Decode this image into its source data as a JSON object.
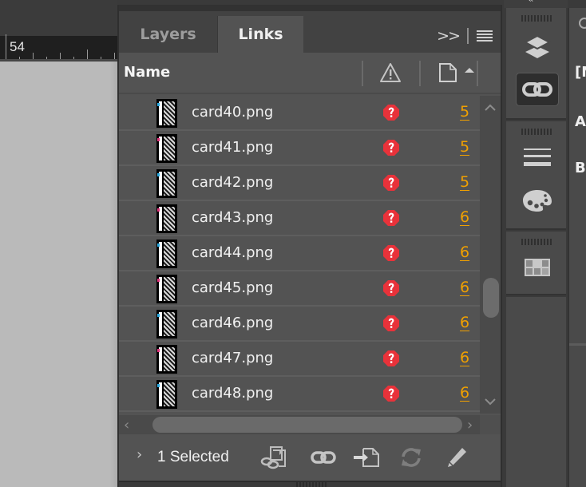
{
  "document": {
    "ruler_label": "54"
  },
  "panel": {
    "tabs": [
      {
        "label": "Layers",
        "active": false
      },
      {
        "label": "Links",
        "active": true
      }
    ],
    "collapse_icon": "double-chevron-right",
    "menu_icon": "hamburger-menu",
    "columns": {
      "name": "Name",
      "status_icon": "warning-triangle",
      "page_icon": "page",
      "sort": "ascending"
    },
    "rows": [
      {
        "name": "card40.png",
        "status": "missing",
        "page": "5",
        "tag_color": "#29a8e0"
      },
      {
        "name": "card41.png",
        "status": "missing",
        "page": "5",
        "tag_color": "#e0307a"
      },
      {
        "name": "card42.png",
        "status": "missing",
        "page": "5",
        "tag_color": "#29a8e0"
      },
      {
        "name": "card43.png",
        "status": "missing",
        "page": "6",
        "tag_color": "#e0307a"
      },
      {
        "name": "card44.png",
        "status": "missing",
        "page": "6",
        "tag_color": "#29a8e0"
      },
      {
        "name": "card45.png",
        "status": "missing",
        "page": "6",
        "tag_color": "#e0307a"
      },
      {
        "name": "card46.png",
        "status": "missing",
        "page": "6",
        "tag_color": "#29a8e0"
      },
      {
        "name": "card47.png",
        "status": "missing",
        "page": "6",
        "tag_color": "#e0307a"
      },
      {
        "name": "card48.png",
        "status": "missing",
        "page": "6",
        "tag_color": "#29a8e0"
      }
    ],
    "footer": {
      "selected_label": "1 Selected",
      "actions": [
        {
          "name": "relink-from-cc-libraries",
          "enabled": true
        },
        {
          "name": "relink",
          "enabled": true
        },
        {
          "name": "go-to-link",
          "enabled": true
        },
        {
          "name": "update-link",
          "enabled": false
        },
        {
          "name": "edit-original",
          "enabled": true
        }
      ]
    }
  },
  "right_strip": {
    "icons": [
      "layers",
      "links",
      "stroke",
      "swatches",
      "pages-grid"
    ],
    "active": "links"
  },
  "far_right_panel": {
    "lines": [
      "[N",
      "A-",
      "B-"
    ]
  },
  "colors": {
    "accent_page_number": "#f0a000",
    "missing_status": "#e8323a",
    "panel_bg": "#535353"
  }
}
